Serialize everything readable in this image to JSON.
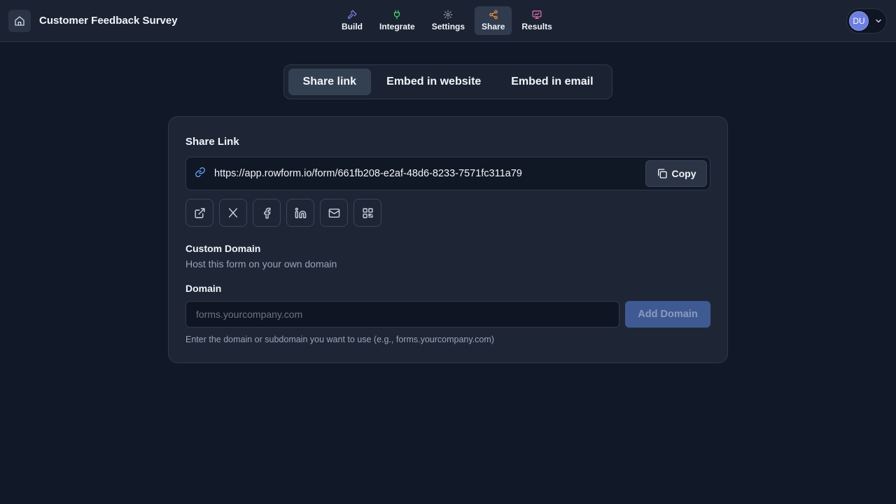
{
  "header": {
    "home_icon": "home-icon",
    "title": "Customer Feedback Survey",
    "nav": [
      {
        "label": "Build",
        "icon": "hammer-icon",
        "color": "#818cf8"
      },
      {
        "label": "Integrate",
        "icon": "plug-icon",
        "color": "#4ade80"
      },
      {
        "label": "Settings",
        "icon": "gear-icon",
        "color": "#94a3b8"
      },
      {
        "label": "Share",
        "icon": "share-icon",
        "color": "#fb923c",
        "active": true
      },
      {
        "label": "Results",
        "icon": "chart-monitor-icon",
        "color": "#f472b6"
      }
    ],
    "user": {
      "initials": "DU",
      "avatar_color": "#6d7ee0"
    }
  },
  "share_tabs": [
    {
      "label": "Share link",
      "active": true
    },
    {
      "label": "Embed in website"
    },
    {
      "label": "Embed in email"
    }
  ],
  "share_card": {
    "title": "Share Link",
    "url": "https://app.rowform.io/form/661fb208-e2af-48d6-8233-7571fc311a79",
    "copy_label": "Copy",
    "share_options": [
      "external-link-icon",
      "x-twitter-icon",
      "facebook-icon",
      "linkedin-icon",
      "mail-icon",
      "qr-code-icon"
    ]
  },
  "custom_domain": {
    "title": "Custom Domain",
    "subtitle": "Host this form on your own domain",
    "field_label": "Domain",
    "placeholder": "forms.yourcompany.com",
    "value": "",
    "add_label": "Add Domain",
    "hint": "Enter the domain or subdomain you want to use (e.g., forms.yourcompany.com)"
  },
  "colors": {
    "background": "#111827",
    "topbar": "#1b2332",
    "card": "#1e2636",
    "accent_disabled": "#3f5a93",
    "link_icon": "#60a5fa"
  }
}
